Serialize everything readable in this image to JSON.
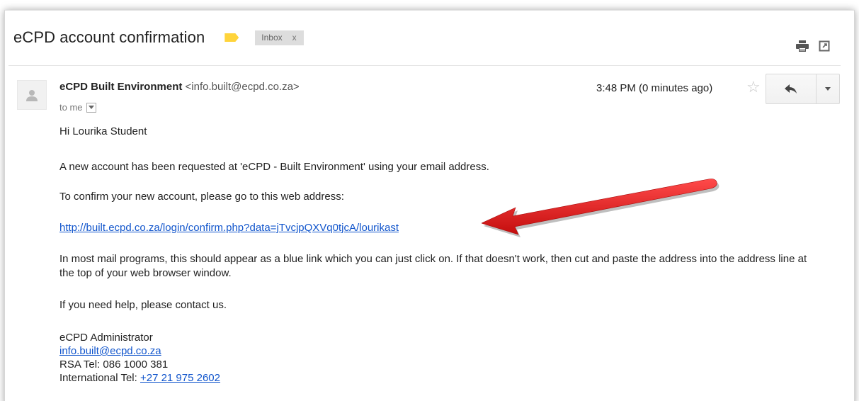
{
  "email": {
    "subject": "eCPD account confirmation",
    "label_chip": "Inbox",
    "label_chip_close": "x",
    "sender_name": "eCPD Built Environment",
    "sender_email": "<info.built@ecpd.co.za>",
    "to_line": "to me",
    "time": "3:48 PM (0 minutes ago)",
    "body": {
      "greeting": "Hi Lourika Student",
      "para1": "A new account has been requested at 'eCPD - Built Environment' using your email address.",
      "para2": "To confirm your new account, please go to this web address:",
      "confirm_link": "http://built.ecpd.co.za/login/confirm.php?data=jTvcjpQXVq0tjcA/lourikast",
      "para3": "In most mail programs, this should appear as a blue link which you can just click on. If that doesn't work, then cut and paste the address into the address line at the top of your web browser window.",
      "para4": "If you need help, please contact us.",
      "signature": {
        "name": "eCPD Administrator",
        "email": "info.built@ecpd.co.za",
        "rsa_tel": "RSA Tel: 086 1000 381",
        "intl_tel_label": "International Tel: ",
        "intl_tel_link": "+27 21 975 2602"
      }
    }
  },
  "icons": {
    "label": "label-tag-icon",
    "print": "print-icon",
    "popout": "new-window-icon",
    "star": "star-icon",
    "reply": "reply-icon",
    "more": "chevron-down-icon",
    "avatar": "person-icon"
  },
  "colors": {
    "label_tag": "#ffd43b",
    "link": "#1155cc",
    "arrow": "#e01b1b"
  }
}
